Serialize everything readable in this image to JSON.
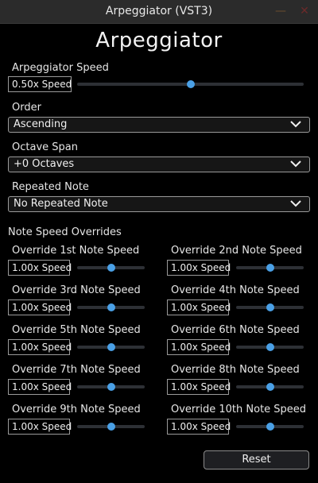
{
  "window": {
    "title": "Arpeggiator (VST3)",
    "minimize_glyph": "—",
    "close_glyph": "✕"
  },
  "header": {
    "title": "Arpeggiator"
  },
  "speed": {
    "label": "Arpeggiator Speed",
    "value": "0.50x Speed",
    "slider_level": 0.5
  },
  "order": {
    "label": "Order",
    "selected": "Ascending"
  },
  "octave_span": {
    "label": "Octave Span",
    "selected": "+0 Octaves"
  },
  "repeated_note": {
    "label": "Repeated Note",
    "selected": "No Repeated Note"
  },
  "overrides": {
    "section_label": "Note Speed Overrides",
    "items": [
      {
        "label": "Override 1st Note Speed",
        "value": "1.00x Speed",
        "slider_level": 0.5
      },
      {
        "label": "Override 2nd Note Speed",
        "value": "1.00x Speed",
        "slider_level": 0.5
      },
      {
        "label": "Override 3rd Note Speed",
        "value": "1.00x Speed",
        "slider_level": 0.5
      },
      {
        "label": "Override 4th Note Speed",
        "value": "1.00x Speed",
        "slider_level": 0.5
      },
      {
        "label": "Override 5th Note Speed",
        "value": "1.00x Speed",
        "slider_level": 0.5
      },
      {
        "label": "Override 6th Note Speed",
        "value": "1.00x Speed",
        "slider_level": 0.5
      },
      {
        "label": "Override 7th Note Speed",
        "value": "1.00x Speed",
        "slider_level": 0.5
      },
      {
        "label": "Override 8th Note Speed",
        "value": "1.00x Speed",
        "slider_level": 0.5
      },
      {
        "label": "Override 9th Note Speed",
        "value": "1.00x Speed",
        "slider_level": 0.5
      },
      {
        "label": "Override 10th Note Speed",
        "value": "1.00x Speed",
        "slider_level": 0.5
      }
    ]
  },
  "reset_label": "Reset",
  "colors": {
    "accent": "#4aa0e6",
    "background": "#000000",
    "titlebar": "#2b2b2b"
  }
}
